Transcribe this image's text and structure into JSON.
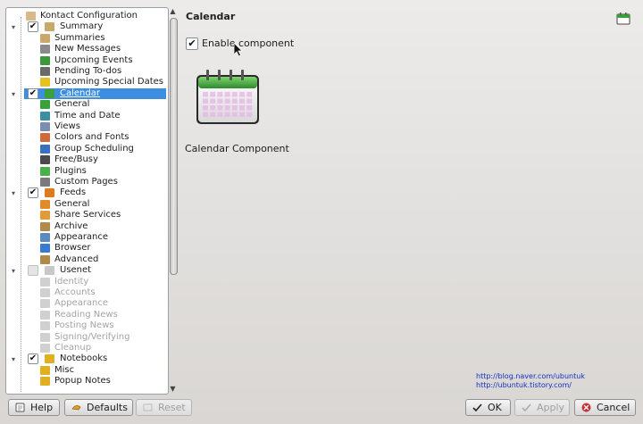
{
  "tree": {
    "rows": [
      {
        "label": "Kontact Configuration",
        "indent": 0,
        "icon": "kontact-icon",
        "iconColor": "#d7b98a",
        "checkbox": false,
        "toggle": ""
      },
      {
        "label": "Summary",
        "indent": 1,
        "icon": "summary-icon",
        "iconColor": "#c9a86b",
        "checkbox": true,
        "checked": true,
        "toggle": "-"
      },
      {
        "label": "Summaries",
        "indent": 2,
        "icon": "summaries-icon",
        "iconColor": "#c9a86b"
      },
      {
        "label": "New Messages",
        "indent": 2,
        "icon": "new-messages-icon",
        "iconColor": "#8a8a8a"
      },
      {
        "label": "Upcoming Events",
        "indent": 2,
        "icon": "upcoming-events-icon",
        "iconColor": "#3a9a3a"
      },
      {
        "label": "Pending To-dos",
        "indent": 2,
        "icon": "pending-todos-icon",
        "iconColor": "#6a6a6a"
      },
      {
        "label": "Upcoming Special Dates",
        "indent": 2,
        "icon": "special-dates-icon",
        "iconColor": "#e8c020"
      },
      {
        "label": "Calendar",
        "indent": 1,
        "icon": "calendar-icon",
        "iconColor": "#3aa03a",
        "checkbox": true,
        "checked": true,
        "toggle": "-",
        "selected": true
      },
      {
        "label": "General",
        "indent": 2,
        "icon": "general-icon",
        "iconColor": "#3aa03a"
      },
      {
        "label": "Time and Date",
        "indent": 2,
        "icon": "time-date-icon",
        "iconColor": "#3a90a0"
      },
      {
        "label": "Views",
        "indent": 2,
        "icon": "views-icon",
        "iconColor": "#7a8fb0"
      },
      {
        "label": "Colors and Fonts",
        "indent": 2,
        "icon": "colors-fonts-icon",
        "iconColor": "#d06a3a"
      },
      {
        "label": "Group Scheduling",
        "indent": 2,
        "icon": "group-scheduling-icon",
        "iconColor": "#3a70c0"
      },
      {
        "label": "Free/Busy",
        "indent": 2,
        "icon": "free-busy-icon",
        "iconColor": "#4a4a4a"
      },
      {
        "label": "Plugins",
        "indent": 2,
        "icon": "plugins-icon",
        "iconColor": "#4ab04a"
      },
      {
        "label": "Custom Pages",
        "indent": 2,
        "icon": "custom-pages-icon",
        "iconColor": "#7a7a7a"
      },
      {
        "label": "Feeds",
        "indent": 1,
        "icon": "feeds-icon",
        "iconColor": "#e07a1a",
        "checkbox": true,
        "checked": true,
        "toggle": "-"
      },
      {
        "label": "General",
        "indent": 2,
        "icon": "feeds-general-icon",
        "iconColor": "#e08a2a"
      },
      {
        "label": "Share Services",
        "indent": 2,
        "icon": "share-services-icon",
        "iconColor": "#e09a3a"
      },
      {
        "label": "Archive",
        "indent": 2,
        "icon": "archive-icon",
        "iconColor": "#b08a4a"
      },
      {
        "label": "Appearance",
        "indent": 2,
        "icon": "appearance-icon",
        "iconColor": "#5a8ac0"
      },
      {
        "label": "Browser",
        "indent": 2,
        "icon": "browser-icon",
        "iconColor": "#3a7ad0"
      },
      {
        "label": "Advanced",
        "indent": 2,
        "icon": "advanced-icon",
        "iconColor": "#b08a4a"
      },
      {
        "label": "Usenet",
        "indent": 1,
        "icon": "usenet-icon",
        "iconColor": "#c8c8c8",
        "checkbox": true,
        "checked": false,
        "disabledCheck": true,
        "toggle": "-"
      },
      {
        "label": "Identity",
        "indent": 2,
        "icon": "identity-icon",
        "iconColor": "#d0d0d0",
        "disabled": true
      },
      {
        "label": "Accounts",
        "indent": 2,
        "icon": "accounts-icon",
        "iconColor": "#d0d0d0",
        "disabled": true
      },
      {
        "label": "Appearance",
        "indent": 2,
        "icon": "usenet-appearance-icon",
        "iconColor": "#d0d0d0",
        "disabled": true
      },
      {
        "label": "Reading News",
        "indent": 2,
        "icon": "reading-news-icon",
        "iconColor": "#d0d0d0",
        "disabled": true
      },
      {
        "label": "Posting News",
        "indent": 2,
        "icon": "posting-news-icon",
        "iconColor": "#d0d0d0",
        "disabled": true
      },
      {
        "label": "Signing/Verifying",
        "indent": 2,
        "icon": "signing-verifying-icon",
        "iconColor": "#d0d0d0",
        "disabled": true
      },
      {
        "label": "Cleanup",
        "indent": 2,
        "icon": "cleanup-icon",
        "iconColor": "#d0d0d0",
        "disabled": true
      },
      {
        "label": "Notebooks",
        "indent": 1,
        "icon": "notebooks-icon",
        "iconColor": "#e0b020",
        "checkbox": true,
        "checked": true,
        "toggle": "-"
      },
      {
        "label": "Misc",
        "indent": 2,
        "icon": "misc-icon",
        "iconColor": "#e0b020"
      },
      {
        "label": "Popup Notes",
        "indent": 2,
        "icon": "popup-notes-icon",
        "iconColor": "#e0b020"
      }
    ]
  },
  "panel": {
    "title": "Calendar",
    "enable_label": "Enable component",
    "enable_checked": true,
    "component_name": "Calendar Component"
  },
  "links": {
    "line1": "http://blog.naver.com/ubuntuk",
    "line2": "http://ubuntuk.tistory.com/"
  },
  "buttons": {
    "help": "Help",
    "defaults": "Defaults",
    "reset": "Reset",
    "ok": "OK",
    "apply": "Apply",
    "cancel": "Cancel"
  },
  "colors": {
    "selection": "#3d8ee0",
    "calendar_green": "#3aa03a",
    "link": "#1030c0"
  }
}
